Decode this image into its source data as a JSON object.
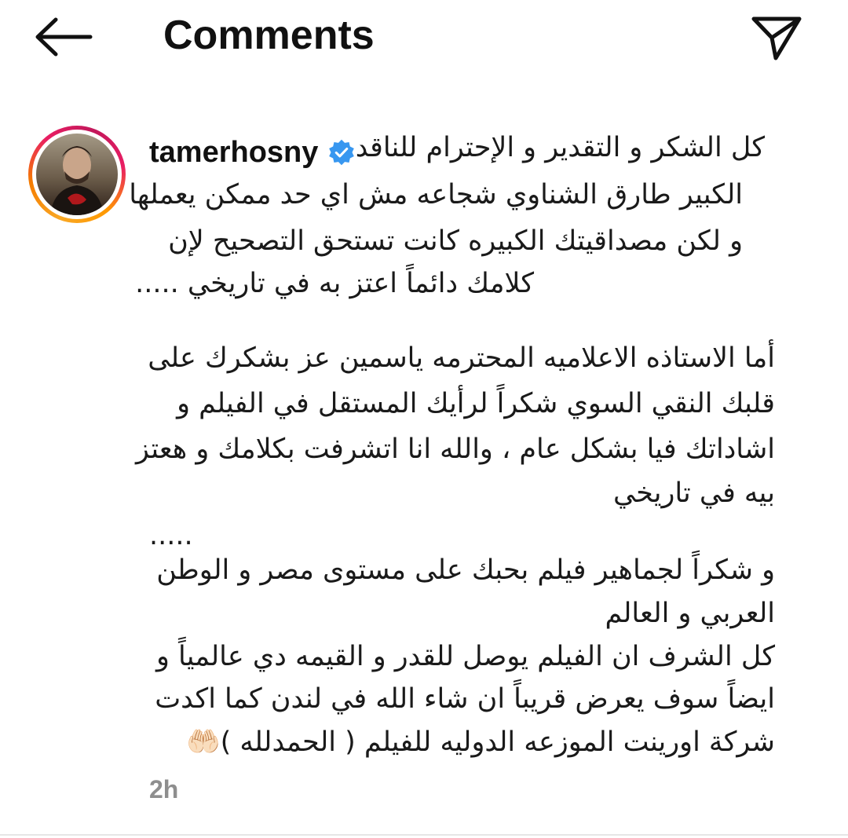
{
  "header": {
    "title": "Comments",
    "back_icon": "arrow-left-icon",
    "send_icon": "paper-plane-icon"
  },
  "comment": {
    "username": "tamerhosny",
    "verified_icon": "verified-badge-icon",
    "timestamp": "2h",
    "lines": [
      "كل الشكر و التقدير و الإحترام للناقد",
      "الكبير طارق الشناوي  شجاعه مش اي حد ممكن يعملها",
      "و لكن مصداقيتك الكبيره كانت  تستحق التصحيح  لإن",
      "كلامك دائماً اعتز به في تاريخي .....",
      "أما الاستاذه الاعلاميه المحترمه ياسمين عز بشكرك على",
      "قلبك النقي السوي شكراً لرأيك المستقل في الفيلم و",
      "اشاداتك فيا بشكل عام ، والله انا اتشرفت بكلامك و هعتز",
      "بيه في تاريخي",
      ".....",
      "و شكراً لجماهير فيلم بحبك على مستوى مصر و الوطن",
      "العربي و العالم",
      " كل الشرف ان الفيلم يوصل للقدر و القيمه دي عالمياً و",
      "ايضاً سوف يعرض قريباً ان شاء الله في لندن كما اكدت",
      "شركة اورينت الموزعه الدوليه للفيلم ( الحمدلله )🤲🏻"
    ]
  },
  "colors": {
    "accent_verified": "#3897f0",
    "timestamp": "#8e8e8e",
    "text": "#111111",
    "divider": "#e6e6e6"
  }
}
